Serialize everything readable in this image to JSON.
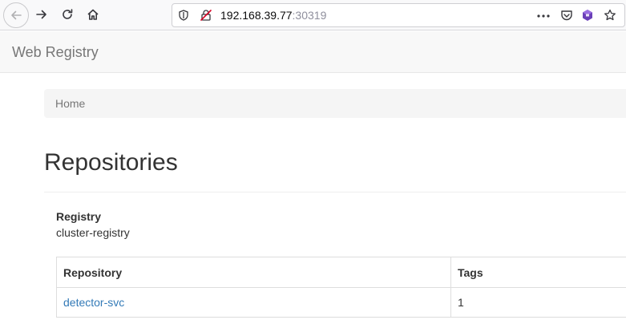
{
  "browser": {
    "url_host": "192.168.39.77",
    "url_port": ":30319",
    "icons": {
      "back": "back-arrow-icon",
      "forward": "forward-arrow-icon",
      "reload": "reload-icon",
      "home": "home-icon",
      "tracking_protection": "shield-icon",
      "insecure": "insecure-lock-icon",
      "page_actions": "meatball-menu-icon",
      "pocket": "pocket-icon",
      "extension": "extension-icon",
      "bookmark": "star-icon"
    }
  },
  "navbar": {
    "brand": "Web Registry"
  },
  "breadcrumb": {
    "items": [
      {
        "label": "Home"
      }
    ]
  },
  "page": {
    "title": "Repositories"
  },
  "registry": {
    "label": "Registry",
    "value": "cluster-registry"
  },
  "table": {
    "headers": {
      "repository": "Repository",
      "tags": "Tags"
    },
    "rows": [
      {
        "repository": "detector-svc",
        "tags": "1"
      }
    ]
  },
  "colors": {
    "link": "#337ab7",
    "navbar_bg": "#f8f8f8",
    "breadcrumb_bg": "#f5f5f5",
    "text": "#333333",
    "muted": "#777777"
  }
}
